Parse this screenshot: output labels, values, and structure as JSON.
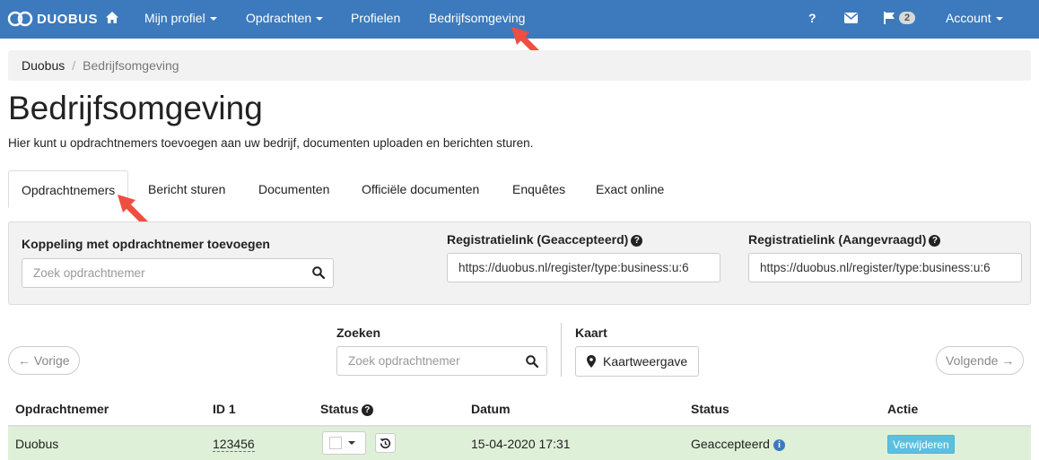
{
  "nav": {
    "logo_text": "DUOBUS",
    "items": [
      {
        "label": "Mijn profiel"
      },
      {
        "label": "Opdrachten"
      },
      {
        "label": "Profielen"
      },
      {
        "label": "Bedrijfsomgeving"
      }
    ],
    "help": "?",
    "flag_count": "2",
    "account": "Account",
    "brand_color": "#3c7abd"
  },
  "breadcrumb": {
    "home": "Duobus",
    "sep": "/",
    "current": "Bedrijfsomgeving"
  },
  "page": {
    "title": "Bedrijfsomgeving",
    "lead": "Hier kunt u opdrachtnemers toevoegen aan uw bedrijf, documenten uploaden en berichten sturen."
  },
  "tabs": [
    "Opdrachtnemers",
    "Bericht sturen",
    "Documenten",
    "Officiële documenten",
    "Enquêtes",
    "Exact online"
  ],
  "panel": {
    "koppeling_label": "Koppeling met opdrachtnemer toevoegen",
    "koppeling_placeholder": "Zoek opdrachtnemer",
    "reg_accepted_label": "Registratielink (Geaccepteerd)",
    "reg_accepted_value": "https://duobus.nl/register/type:business:u:6",
    "reg_requested_label": "Registratielink (Aangevraagd)",
    "reg_requested_value": "https://duobus.nl/register/type:business:u:6"
  },
  "toolbar": {
    "prev": "← Vorige",
    "next": "Volgende →",
    "search_label": "Zoeken",
    "search_placeholder": "Zoek opdrachtnemer",
    "map_label": "Kaart",
    "map_button": "Kaartweergave"
  },
  "table": {
    "headers": [
      "Opdrachtnemer",
      "ID 1",
      "Status",
      "Datum",
      "Status",
      "Actie"
    ],
    "rows": [
      {
        "name": "Duobus",
        "id": "123456",
        "date": "15-04-2020 17:31",
        "status": "Geaccepteerd",
        "action": "Verwijderen"
      }
    ]
  }
}
